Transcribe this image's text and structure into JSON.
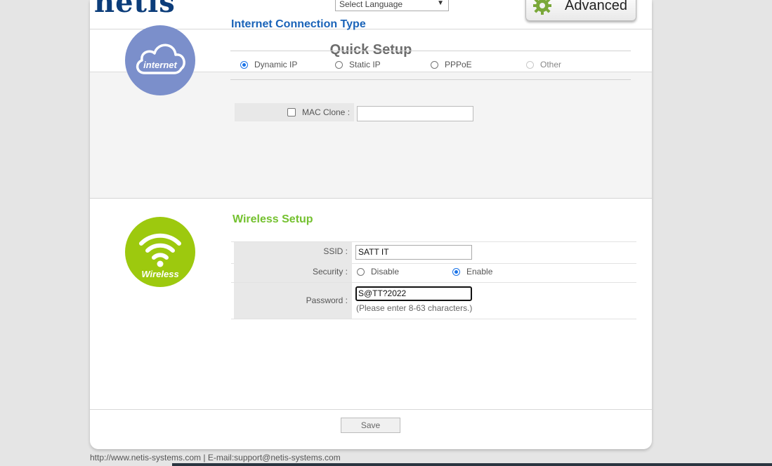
{
  "header": {
    "logo_text": "netis",
    "language_select": {
      "selected": "Select Language"
    },
    "advanced_button": {
      "label": "Advanced",
      "icon": "gear-icon"
    }
  },
  "page_title": "Quick Setup",
  "internet": {
    "icon_label": "internet",
    "icon_color": "#7b8fcb",
    "title": "Internet Connection Type",
    "options": [
      {
        "label": "Dynamic IP",
        "selected": true,
        "disabled": false
      },
      {
        "label": "Static IP",
        "selected": false,
        "disabled": false
      },
      {
        "label": "PPPoE",
        "selected": false,
        "disabled": false
      },
      {
        "label": "Other",
        "selected": false,
        "disabled": true
      }
    ],
    "mac_clone": {
      "label": "MAC Clone :",
      "checked": false,
      "value": ""
    }
  },
  "wireless": {
    "icon_label": "Wireless",
    "icon_color": "#9dc90e",
    "title": "Wireless Setup",
    "ssid": {
      "label": "SSID :",
      "value": "SATT IT"
    },
    "security": {
      "label": "Security :",
      "options": [
        {
          "label": "Disable",
          "selected": false
        },
        {
          "label": "Enable",
          "selected": true
        }
      ]
    },
    "password": {
      "label": "Password :",
      "value": "S@TT?2022",
      "hint": "(Please enter 8-63 characters.)"
    }
  },
  "save_button": {
    "label": "Save"
  },
  "footer": {
    "text": "http://www.netis-systems.com | E-mail:support@netis-systems.com"
  },
  "colors": {
    "title_blue": "#1a63b8",
    "title_green": "#74c12f",
    "logo": "#0c3d7a"
  }
}
